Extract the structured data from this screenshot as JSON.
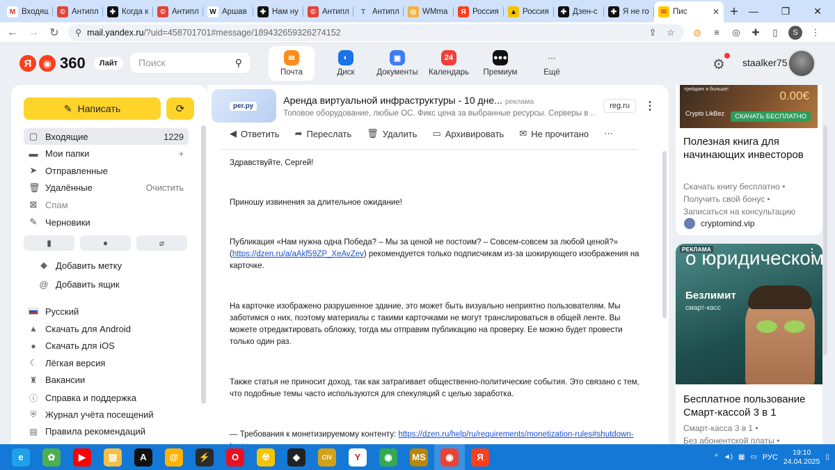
{
  "browser": {
    "tabs": [
      {
        "title": "Входящ",
        "fav_color": "#ffffff",
        "fav_text": "M",
        "fav_fg": "#d93025"
      },
      {
        "title": "Антипл",
        "fav_color": "#e0453a",
        "fav_text": "©",
        "fav_fg": "#ffffff"
      },
      {
        "title": "Когда к",
        "fav_color": "#111111",
        "fav_text": "✚",
        "fav_fg": "#ffffff"
      },
      {
        "title": "Антипл",
        "fav_color": "#e0453a",
        "fav_text": "©",
        "fav_fg": "#ffffff"
      },
      {
        "title": "Аршав",
        "fav_color": "#ffffff",
        "fav_text": "W",
        "fav_fg": "#111111"
      },
      {
        "title": "Нам ну",
        "fav_color": "#111111",
        "fav_text": "✚",
        "fav_fg": "#ffffff"
      },
      {
        "title": "Антипл",
        "fav_color": "#e0453a",
        "fav_text": "©",
        "fav_fg": "#ffffff"
      },
      {
        "title": "Антипл",
        "fav_color": "#cfe1fb",
        "fav_text": "T",
        "fav_fg": "#2a6fd6"
      },
      {
        "title": "WMma",
        "fav_color": "#f2b33d",
        "fav_text": "◎",
        "fav_fg": "#ffffff"
      },
      {
        "title": "Россия",
        "fav_color": "#fc3f1d",
        "fav_text": "Я",
        "fav_fg": "#ffffff"
      },
      {
        "title": "Россия",
        "fav_color": "#f5c400",
        "fav_text": "▲",
        "fav_fg": "#111111"
      },
      {
        "title": "Дзен-с",
        "fav_color": "#111111",
        "fav_text": "✚",
        "fav_fg": "#ffffff"
      },
      {
        "title": "Я не го",
        "fav_color": "#111111",
        "fav_text": "✚",
        "fav_fg": "#ffffff"
      },
      {
        "title": "Пис",
        "fav_color": "#ffcc00",
        "fav_text": "✉",
        "fav_fg": "#e2462b",
        "active": true
      }
    ],
    "new_tab": "+",
    "window_controls": {
      "minimize": "⌄",
      "min": "—",
      "max": "❐",
      "close": "✕"
    },
    "url_host": "mail.yandex.ru",
    "url_rest": "/?uid=458701701#message/189432659326274152",
    "profile_letter": "S"
  },
  "header": {
    "logo_text": "360",
    "lite_badge": "Лайт",
    "search_placeholder": "Поиск",
    "services": [
      {
        "label": "Почта",
        "color": "#ff8c1a",
        "glyph": "✉",
        "active": true
      },
      {
        "label": "Диск",
        "color": "#1a73e8",
        "glyph": "◐"
      },
      {
        "label": "Документы",
        "color": "#3d7cf5",
        "glyph": "▣"
      },
      {
        "label": "Календарь",
        "color": "#f1403a",
        "glyph": "24"
      },
      {
        "label": "Премиум",
        "color": "#111111",
        "glyph": "●●●"
      },
      {
        "label": "Ещё",
        "color": "transparent",
        "glyph": "⋯"
      }
    ],
    "username": "staalker75"
  },
  "sidebar": {
    "compose_label": "Написать",
    "folders": [
      {
        "label": "Входящие",
        "count": "1229",
        "icon": "inbox-icon",
        "glyph": "▢",
        "selected": true
      },
      {
        "label": "Мои папки",
        "action": "+",
        "icon": "folder-icon",
        "glyph": "▬"
      },
      {
        "label": "Отправленные",
        "icon": "send-icon",
        "glyph": "➤"
      },
      {
        "label": "Удалённые",
        "action": "Очистить",
        "icon": "trash-icon",
        "glyph": "🗑"
      },
      {
        "label": "Спам",
        "icon": "spam-icon",
        "glyph": "⊠",
        "dim": true
      },
      {
        "label": "Черновики",
        "icon": "draft-icon",
        "glyph": "✎"
      }
    ],
    "quick_filters": [
      {
        "name": "bookmark-icon",
        "glyph": "▮"
      },
      {
        "name": "unread-dot-icon",
        "glyph": "●"
      },
      {
        "name": "attachment-icon",
        "glyph": "⌀"
      }
    ],
    "add_label": "Добавить метку",
    "add_mailbox": "Добавить ящик",
    "footer": [
      {
        "label": "Русский",
        "icon": "russian-flag-icon"
      },
      {
        "label": "Скачать для Android",
        "icon": "android-icon",
        "glyph": "▲"
      },
      {
        "label": "Скачать для iOS",
        "icon": "apple-icon",
        "glyph": "●"
      },
      {
        "label": "Лёгкая версия",
        "icon": "light-version-icon",
        "glyph": "☾"
      },
      {
        "label": "Вакансии",
        "icon": "vacancies-icon",
        "glyph": "♜"
      },
      {
        "label": "Справка и поддержка",
        "icon": "help-icon",
        "glyph": "ⓘ"
      },
      {
        "label": "Журнал учёта посещений",
        "icon": "shield-icon",
        "glyph": "⛨"
      },
      {
        "label": "Правила рекомендаций",
        "icon": "rules-icon",
        "glyph": "▤"
      }
    ]
  },
  "message": {
    "ad": {
      "image_badge": "рег.ру",
      "title": "Аренда виртуальной инфраструктуры - 10 дне...",
      "tag": "реклама",
      "subtitle": "Топовое оборудование, любые ОС. Фикс цена за выбранные ресурсы. Серверы в ...",
      "domain": "reg.ru"
    },
    "actions": [
      {
        "label": "Ответить",
        "icon": "reply-icon",
        "glyph": "◀"
      },
      {
        "label": "Переслать",
        "icon": "forward-icon",
        "glyph": "➦"
      },
      {
        "label": "Удалить",
        "icon": "delete-icon",
        "glyph": "🗑"
      },
      {
        "label": "Архивировать",
        "icon": "archive-icon",
        "glyph": "▭"
      },
      {
        "label": "Не прочитано",
        "icon": "unread-icon",
        "glyph": "✉"
      }
    ],
    "more": "⋯",
    "greeting": "Здравствуйте, Сергей!",
    "p1": "Приношу извинения за длительное ожидание!",
    "p2_before": "Публикация «Нам нужна одна Победа? – Мы за ценой не постоим? – Совсем-совсем за любой ценой?» (",
    "p2_link": "https://dzen.ru/a/aAkf59ZP_XeAvZev",
    "p2_after": ") рекомендуется только подписчикам из-за шокирующего изображения на карточке.",
    "p3": "На карточке изображено разрушенное здание, это может быть визуально неприятно пользователям. Мы заботимся о них, поэтому материалы с такими карточками не могут транслироваться в общей ленте. Вы можете отредактировать обложку, тогда мы отправим публикацию на проверку. Ее можно будет провести только один раз.",
    "p4": "Также статья не приносит доход, так как затрагивает общественно-политические события. Это связано с тем, что подобные темы часто используются для спекуляций с целью заработка.",
    "p5_before": "— Требования к монетизируемому контенту: ",
    "p5_link": "https://dzen.ru/help/ru/requirements/monetization-rules#shutdown-terms"
  },
  "right_ads": {
    "ad1": {
      "promo": "трейдинг и больше!",
      "price": "0.00€",
      "logo_text": "Crypto LikBez",
      "cta": "СКАЧАТЬ БЕСПЛАТНО",
      "title": "Полезная книга для начинающих инвесторов",
      "links": [
        "Скачать книгу бесплатно •",
        "Получить свой бонус •",
        "Записаться на консультацию"
      ],
      "domain": "cryptomind.vip"
    },
    "ad2": {
      "label": "РЕКЛАМА",
      "big_text": "о юридическом лице",
      "mid_text": "Безлимит",
      "small_text": "смарт-касс",
      "more": "⋮",
      "title": "Бесплатное пользование Смарт-кассой 3 в 1",
      "links": [
        "Смарт-касса 3 в 1 •",
        "Без абонентской платы •"
      ]
    }
  },
  "taskbar": {
    "icons": [
      {
        "name": "internet-explorer-icon",
        "color": "#1fa0e8",
        "glyph": "e"
      },
      {
        "name": "icq-icon",
        "color": "#4caf50",
        "glyph": "✿"
      },
      {
        "name": "youtube-icon",
        "color": "#ff0000",
        "glyph": "▶"
      },
      {
        "name": "file-explorer-icon",
        "color": "#f2c04a",
        "glyph": "▤"
      },
      {
        "name": "font-app-icon",
        "color": "#111111",
        "glyph": "A"
      },
      {
        "name": "mail-agent-icon",
        "color": "#ffb300",
        "glyph": "@"
      },
      {
        "name": "winamp-icon",
        "color": "#2b2b2b",
        "glyph": "⚡"
      },
      {
        "name": "opera-icon",
        "color": "#e81123",
        "glyph": "O"
      },
      {
        "name": "radiation-app-icon",
        "color": "#f5c400",
        "glyph": "☢"
      },
      {
        "name": "unity-icon",
        "color": "#222222",
        "glyph": "◆"
      },
      {
        "name": "game-icon",
        "color": "#d4a017",
        "glyph": "CIV"
      },
      {
        "name": "yandex-browser-icon",
        "color": "#ffffff",
        "glyph": "Y"
      },
      {
        "name": "chrome-alt-icon",
        "color": "#34a853",
        "glyph": "◉"
      },
      {
        "name": "ms-app-icon",
        "color": "#b8860b",
        "glyph": "MS"
      },
      {
        "name": "chrome-icon",
        "color": "#ea4335",
        "glyph": "◉",
        "active": true
      },
      {
        "name": "yandex-icon",
        "color": "#fc3f1d",
        "glyph": "Я"
      }
    ],
    "lang": "РУС",
    "time": "19:10",
    "date": "24.04.2025"
  }
}
